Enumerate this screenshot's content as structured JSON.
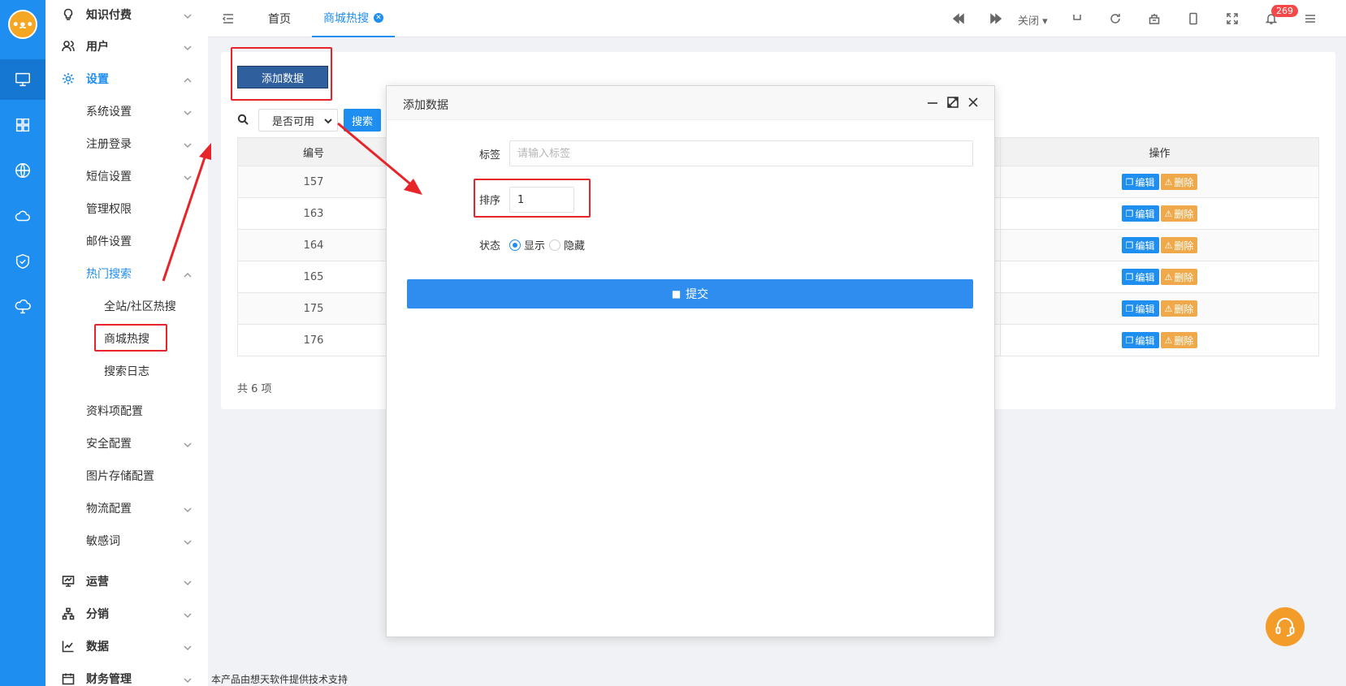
{
  "app": {
    "logo_text": "•ᴥ•"
  },
  "sidebar": {
    "items": [
      {
        "label": "知识付费"
      },
      {
        "label": "用户"
      },
      {
        "label": "设置"
      },
      {
        "label": "系统设置"
      },
      {
        "label": "注册登录"
      },
      {
        "label": "短信设置"
      },
      {
        "label": "管理权限"
      },
      {
        "label": "邮件设置"
      },
      {
        "label": "热门搜索"
      },
      {
        "label": "全站/社区热搜"
      },
      {
        "label": "商城热搜"
      },
      {
        "label": "搜索日志"
      },
      {
        "label": "资料项配置"
      },
      {
        "label": "安全配置"
      },
      {
        "label": "图片存储配置"
      },
      {
        "label": "物流配置"
      },
      {
        "label": "敏感词"
      },
      {
        "label": "运营"
      },
      {
        "label": "分销"
      },
      {
        "label": "数据"
      },
      {
        "label": "财务管理"
      }
    ]
  },
  "topbar": {
    "tabs": [
      {
        "label": "首页"
      },
      {
        "label": "商城热搜"
      }
    ],
    "close_label": "关闭",
    "notification_count": "269"
  },
  "toolbar": {
    "add_label": "添加数据",
    "filter_selected": "是否可用",
    "search_label": "搜索"
  },
  "table": {
    "headers": {
      "id": "编号",
      "action": "操作"
    },
    "rows": [
      {
        "id": "157"
      },
      {
        "id": "163"
      },
      {
        "id": "164"
      },
      {
        "id": "165"
      },
      {
        "id": "175"
      },
      {
        "id": "176"
      }
    ],
    "edit_label": "编辑",
    "delete_label": "删除",
    "total_text": "共 6 项"
  },
  "modal": {
    "title": "添加数据",
    "tag_label": "标签",
    "tag_placeholder": "请输入标签",
    "sort_label": "排序",
    "sort_value": "1",
    "status_label": "状态",
    "status_show": "显示",
    "status_hide": "隐藏",
    "submit_label": "提交"
  },
  "footer": {
    "text": "本产品由想天软件提供技术支持"
  },
  "colors": {
    "accent": "#1f8ef1",
    "highlight": "#e8242b",
    "warning": "#f0a94a"
  }
}
